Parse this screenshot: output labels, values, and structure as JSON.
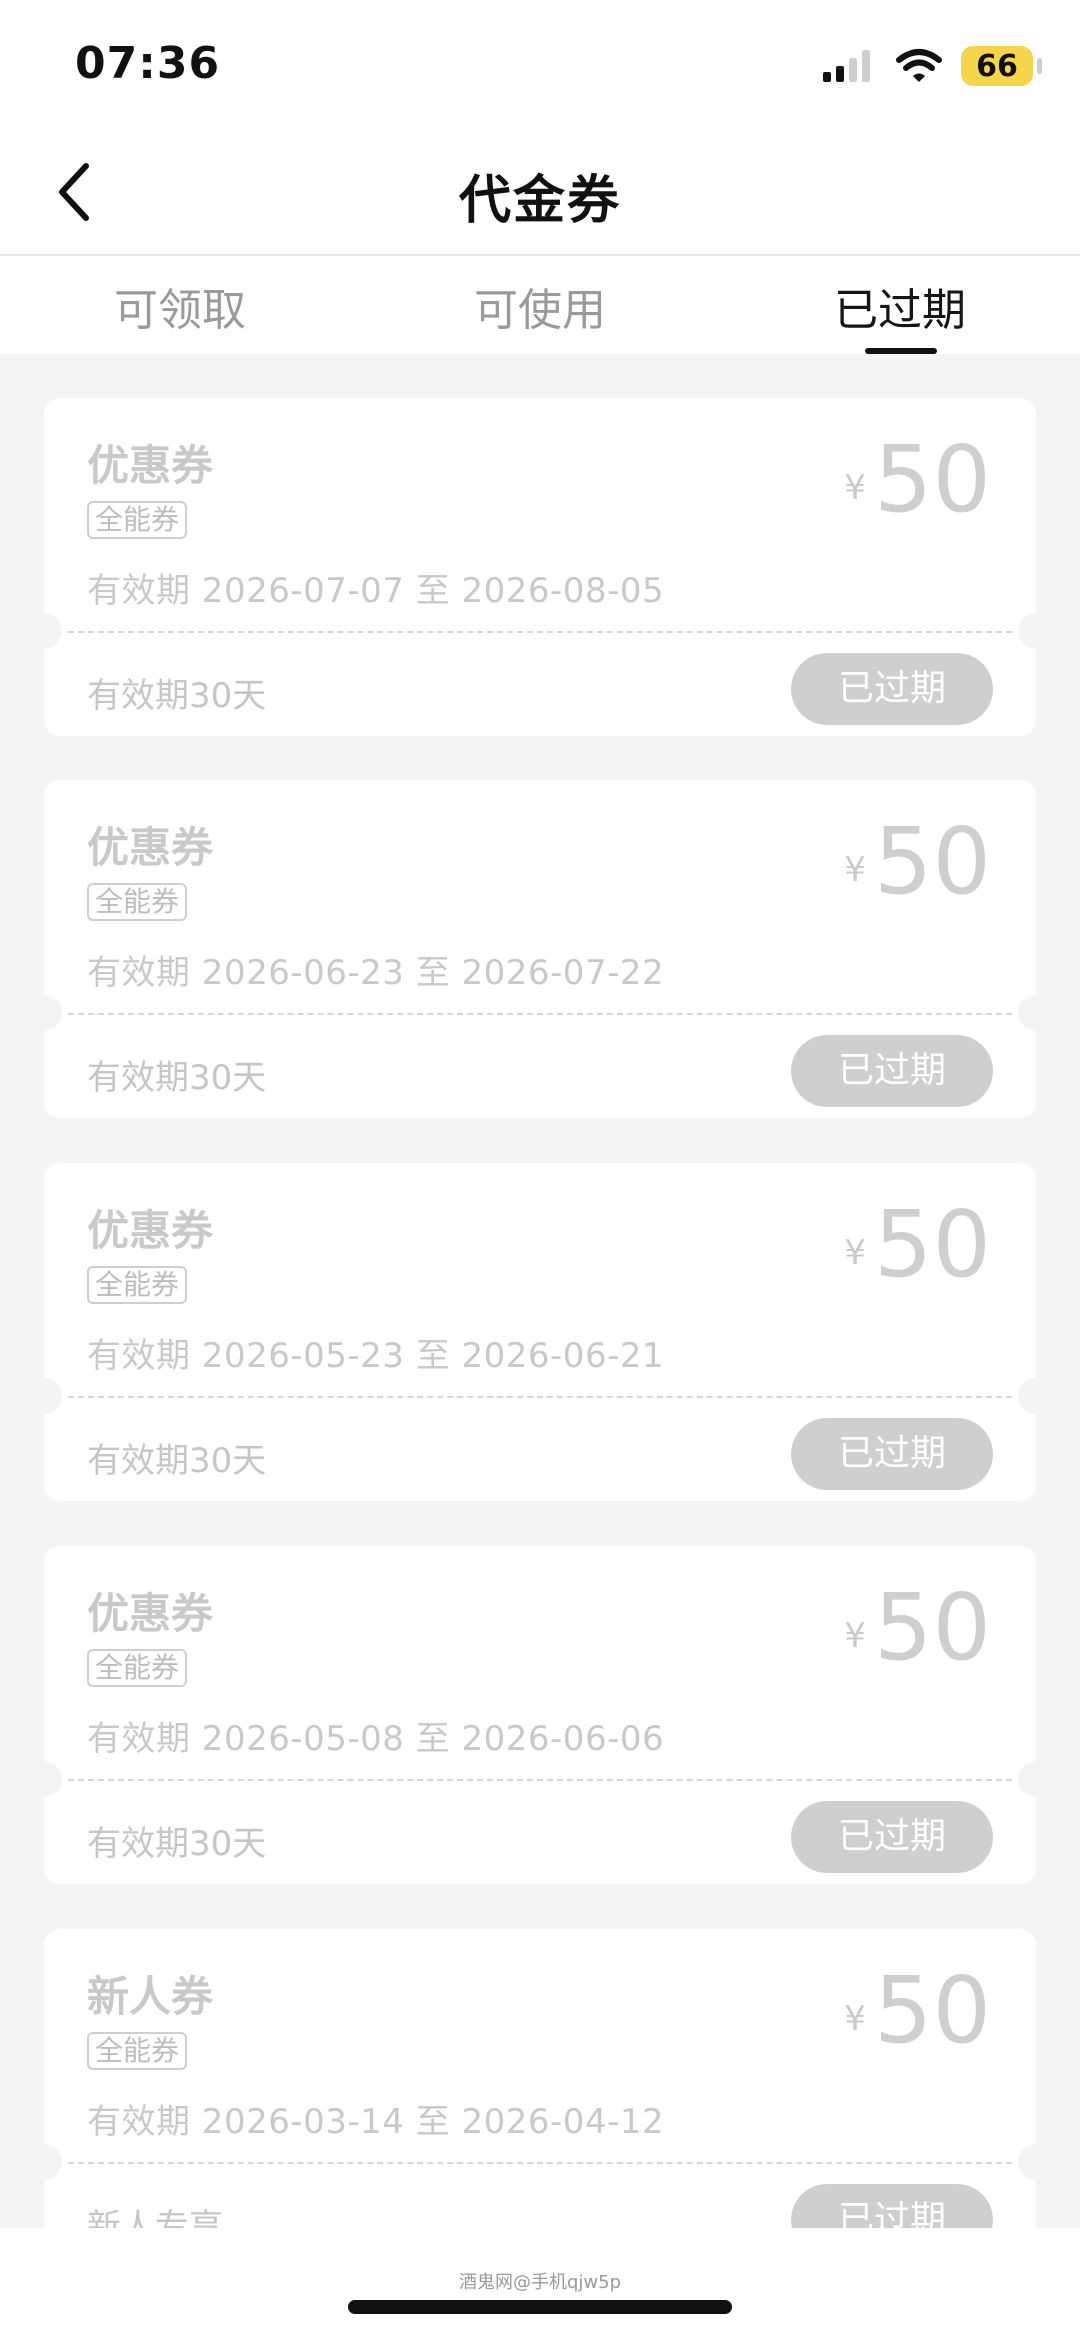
{
  "status_bar": {
    "time": "07:36",
    "battery": "66",
    "icons": [
      "signal-icon",
      "wifi-icon",
      "battery-icon"
    ]
  },
  "nav": {
    "title": "代金券",
    "back_icon": "chevron-left-icon"
  },
  "tabs": [
    {
      "label": "可领取",
      "active": false
    },
    {
      "label": "可使用",
      "active": false
    },
    {
      "label": "已过期",
      "active": true
    }
  ],
  "coupons": [
    {
      "name": "优惠券",
      "badge": "全能券",
      "currency": "¥",
      "amount": "50",
      "validity": "有效期 2026-07-07 至 2026-08-05",
      "days_text": "有效期30天",
      "status": "已过期"
    },
    {
      "name": "优惠券",
      "badge": "全能券",
      "currency": "¥",
      "amount": "50",
      "validity": "有效期 2026-06-23 至 2026-07-22",
      "days_text": "有效期30天",
      "status": "已过期"
    },
    {
      "name": "优惠券",
      "badge": "全能券",
      "currency": "¥",
      "amount": "50",
      "validity": "有效期 2026-05-23 至 2026-06-21",
      "days_text": "有效期30天",
      "status": "已过期"
    },
    {
      "name": "优惠券",
      "badge": "全能券",
      "currency": "¥",
      "amount": "50",
      "validity": "有效期 2026-05-08 至 2026-06-06",
      "days_text": "有效期30天",
      "status": "已过期"
    },
    {
      "name": "新人券",
      "badge": "全能券",
      "currency": "¥",
      "amount": "50",
      "validity": "有效期 2026-03-14 至 2026-04-12",
      "days_text": "新人专享",
      "status": "已过期"
    }
  ],
  "watermark": "酒鬼网@手机qjw5p",
  "colors": {
    "background": "#f4f4f4",
    "card": "#ffffff",
    "expired_text": "#c9c9c9",
    "expired_button": "#cfcfcf",
    "battery": "#f6d54b"
  }
}
